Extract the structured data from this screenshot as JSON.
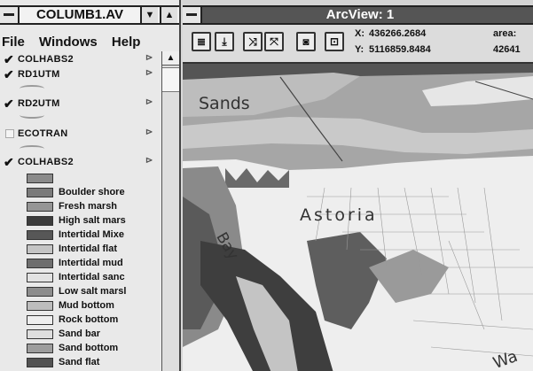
{
  "legend_window": {
    "title": "COLUMB1.AV",
    "minimize_glyph": "▼",
    "maximize_glyph": "▲",
    "menu": [
      "File",
      "Windows",
      "Help"
    ],
    "scroll_up_glyph": "▲",
    "themes": [
      {
        "name": "COLHABS2",
        "checked": true,
        "flag": "⊳"
      },
      {
        "name": "RD1UTM",
        "checked": true,
        "flag": "⊳"
      },
      {
        "name": "RD2UTM",
        "checked": true,
        "flag": "⊳"
      },
      {
        "name": "ECOTRAN",
        "checked": false,
        "flag": "⊳"
      },
      {
        "name": "COLHABS2",
        "checked": true,
        "flag": "⊳"
      }
    ],
    "check_glyph": "✔",
    "classes": [
      {
        "label": "",
        "color": "#8a8a8a"
      },
      {
        "label": "Boulder shore",
        "color": "#7a7a7a"
      },
      {
        "label": "Fresh marsh",
        "color": "#959595"
      },
      {
        "label": "High salt mars",
        "color": "#3c3c3c"
      },
      {
        "label": "Intertidal Mixe",
        "color": "#575757"
      },
      {
        "label": "Intertidal flat",
        "color": "#c4c4c4"
      },
      {
        "label": "Intertidal mud",
        "color": "#6e6e6e"
      },
      {
        "label": "Intertidal sanc",
        "color": "#e2e2e2"
      },
      {
        "label": "Low salt marsl",
        "color": "#8c8c8c"
      },
      {
        "label": "Mud bottom",
        "color": "#bdbdbd"
      },
      {
        "label": "Rock bottom",
        "color": "#eeeeee"
      },
      {
        "label": "Sand bar",
        "color": "#dedede"
      },
      {
        "label": "Sand bottom",
        "color": "#9d9d9d"
      },
      {
        "label": "Sand flat",
        "color": "#525252"
      }
    ]
  },
  "view_window": {
    "title": "ArcView: 1",
    "tools": [
      {
        "icon": "legend-icon",
        "glyph": "≣"
      },
      {
        "icon": "download-icon",
        "glyph": "⤓"
      },
      {
        "icon": "zoom-in-icon",
        "glyph": "⤨"
      },
      {
        "icon": "zoom-out-icon",
        "glyph": "⤧"
      },
      {
        "icon": "camera-icon",
        "glyph": "◙"
      },
      {
        "icon": "hotlink-icon",
        "glyph": "⊡"
      }
    ],
    "x_label": "X:",
    "x_value": "436266.2684",
    "y_label": "Y:",
    "y_value": "5116859.8484",
    "area_label": "area:",
    "area_value": "42641"
  },
  "map": {
    "labels": [
      "Sands",
      "Astoria",
      "Bay",
      "Wa"
    ]
  }
}
